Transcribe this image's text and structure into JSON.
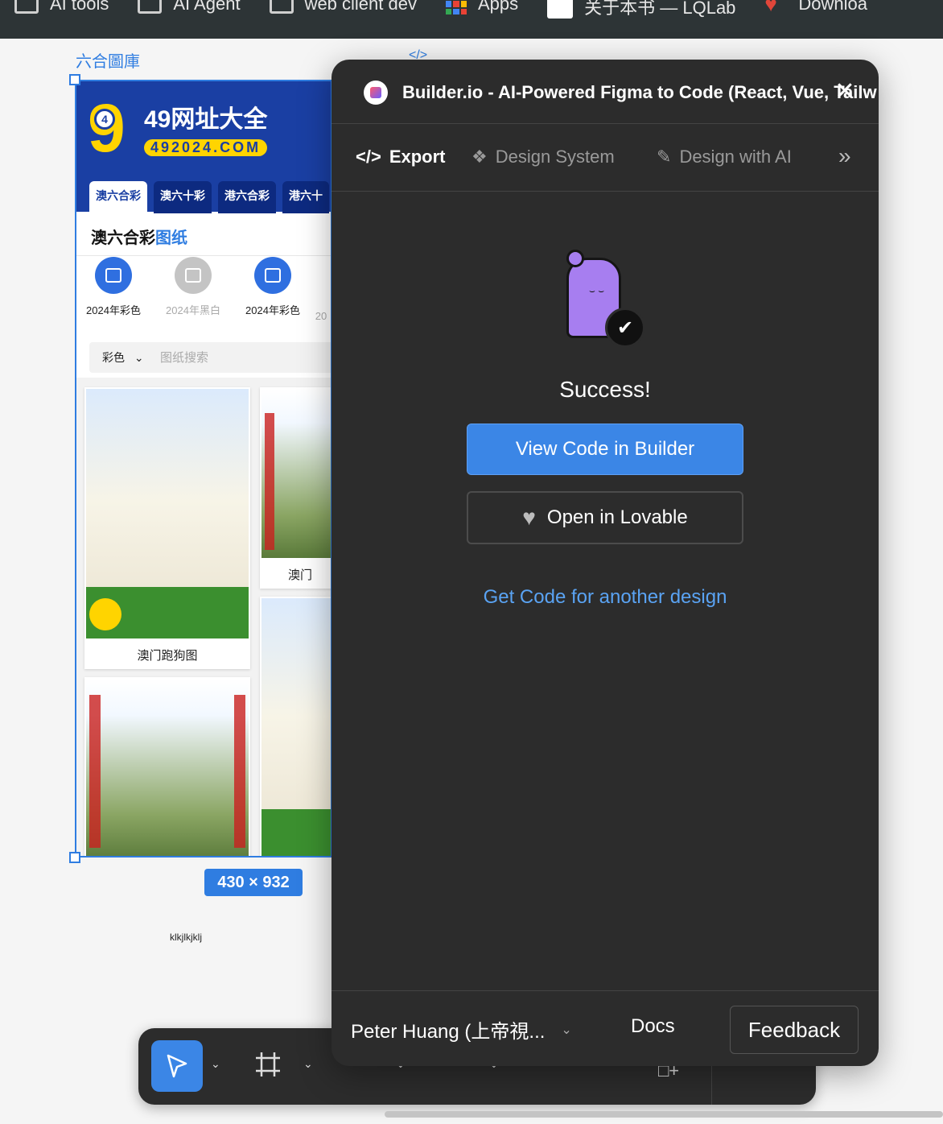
{
  "bookmarks": [
    {
      "label": "AI tools",
      "icon": "folder-icon"
    },
    {
      "label": "AI Agent",
      "icon": "folder-icon"
    },
    {
      "label": "web client dev",
      "icon": "folder-icon"
    },
    {
      "label": "Apps",
      "icon": "apps-grid-icon"
    },
    {
      "label": "关于本书 — LQLab",
      "icon": "avatar-face-icon"
    },
    {
      "label": "Downloa",
      "icon": "heart-icon"
    }
  ],
  "frame": {
    "label": "六合圖庫",
    "code_icon": "</>",
    "size_badge": "430 × 932",
    "stray_text": "klkjlkjklj"
  },
  "site": {
    "logo_digit": "9",
    "logo_ball": "4",
    "title": "49网址大全",
    "domain": "492024.COM",
    "tabs": [
      "澳六合彩",
      "澳六十彩",
      "港六合彩",
      "港六十"
    ],
    "section_title_main": "澳六合彩",
    "section_title_hl": "图纸",
    "categories": [
      {
        "label": "2024年彩色",
        "style": "blue"
      },
      {
        "label": "2024年黑白",
        "style": "gray"
      },
      {
        "label": "2024年彩色",
        "style": "blue"
      },
      {
        "label": "20",
        "style": "gray"
      }
    ],
    "search_select": "彩色",
    "search_placeholder": "图纸搜索",
    "cards": [
      {
        "caption": "澳门跑狗图"
      },
      {
        "caption": "澳门"
      }
    ]
  },
  "plugin": {
    "title": "Builder.io - AI-Powered Figma to Code (React, Vue, Tailw",
    "nav": [
      {
        "label": "Export",
        "icon": "code-icon",
        "active": true
      },
      {
        "label": "Design System",
        "icon": "components-icon",
        "active": false
      },
      {
        "label": "Design with AI",
        "icon": "magic-wand-icon",
        "active": false
      }
    ],
    "success_text": "Success!",
    "primary_button": "View Code in Builder",
    "secondary_button": "Open in Lovable",
    "link_text": "Get Code for another design",
    "footer": {
      "user": "Peter Huang (上帝視...",
      "docs": "Docs",
      "feedback": "Feedback"
    }
  },
  "colors": {
    "accent": "#3b86e6",
    "panel_bg": "#2c2c2c",
    "link": "#5aa3f3",
    "site_blue": "#1a3fa3",
    "site_yellow": "#ffd400"
  }
}
